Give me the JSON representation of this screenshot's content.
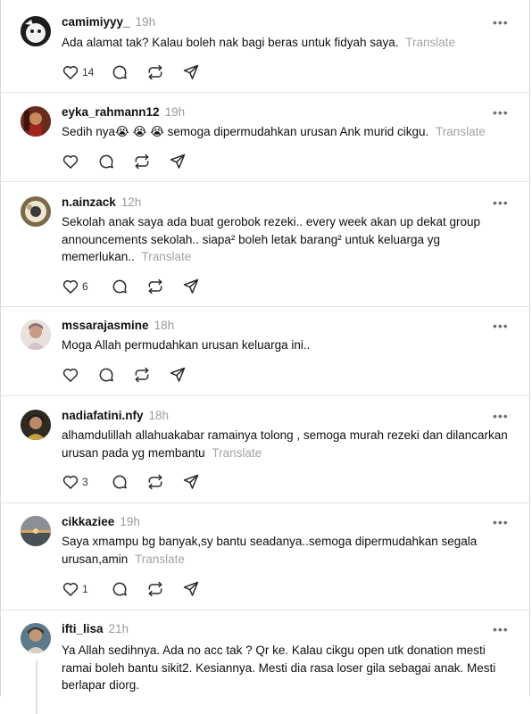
{
  "posts": [
    {
      "username": "camimiyyy_",
      "time": "19h",
      "text": "Ada alamat tak? Kalau boleh nak bagi beras untuk fidyah saya.",
      "translate": "Translate",
      "likes": "14",
      "avatar": "avatar-camimiyyy"
    },
    {
      "username": "eyka_rahmann12",
      "time": "19h",
      "text": "Sedih nya😭 😭 😭  semoga dipermudahkan urusan Ank murid cikgu.",
      "translate": "Translate",
      "likes": "",
      "avatar": "avatar-eyka"
    },
    {
      "username": "n.ainzack",
      "time": "12h",
      "text": "Sekolah anak saya ada buat gerobok rezeki.. every week akan up dekat group announcements sekolah.. siapa² boleh letak barang² untuk keluarga yg memerlukan..",
      "translate": "Translate",
      "likes": "6",
      "avatar": "avatar-ainzack"
    },
    {
      "username": "mssarajasmine",
      "time": "18h",
      "text": "Moga Allah permudahkan urusan keluarga ini..",
      "translate": "",
      "likes": "",
      "avatar": "avatar-mssara"
    },
    {
      "username": "nadiafatini.nfy",
      "time": "18h",
      "text": "alhamdulillah allahuakabar ramainya tolong , semoga murah rezeki dan dilancarkan urusan pada yg membantu",
      "translate": "Translate",
      "likes": "3",
      "avatar": "avatar-nadia"
    },
    {
      "username": "cikkaziee",
      "time": "19h",
      "text": "Saya xmampu bg banyak,sy bantu seadanya..semoga dipermudahkan segala urusan,amin",
      "translate": "Translate",
      "likes": "1",
      "avatar": "avatar-cikkaziee"
    },
    {
      "username": "ifti_lisa",
      "time": "21h",
      "text": "Ya Allah sedihnya. Ada no acc tak ? Qr ke. Kalau cikgu open utk donation mesti ramai boleh bantu sikit2. Kesiannya. Mesti dia rasa loser gila sebagai anak. Mesti berlapar diorg.",
      "translate": "",
      "likes": "",
      "avatar": "avatar-ifti"
    }
  ],
  "menu_label": "•••",
  "colors": {
    "text": "#101010",
    "muted": "#9a9a9a",
    "icon": "#2b2b2b",
    "divider": "#e3e3e3"
  },
  "icons": [
    "heart-icon",
    "comment-icon",
    "repost-icon",
    "share-icon",
    "more-icon"
  ]
}
